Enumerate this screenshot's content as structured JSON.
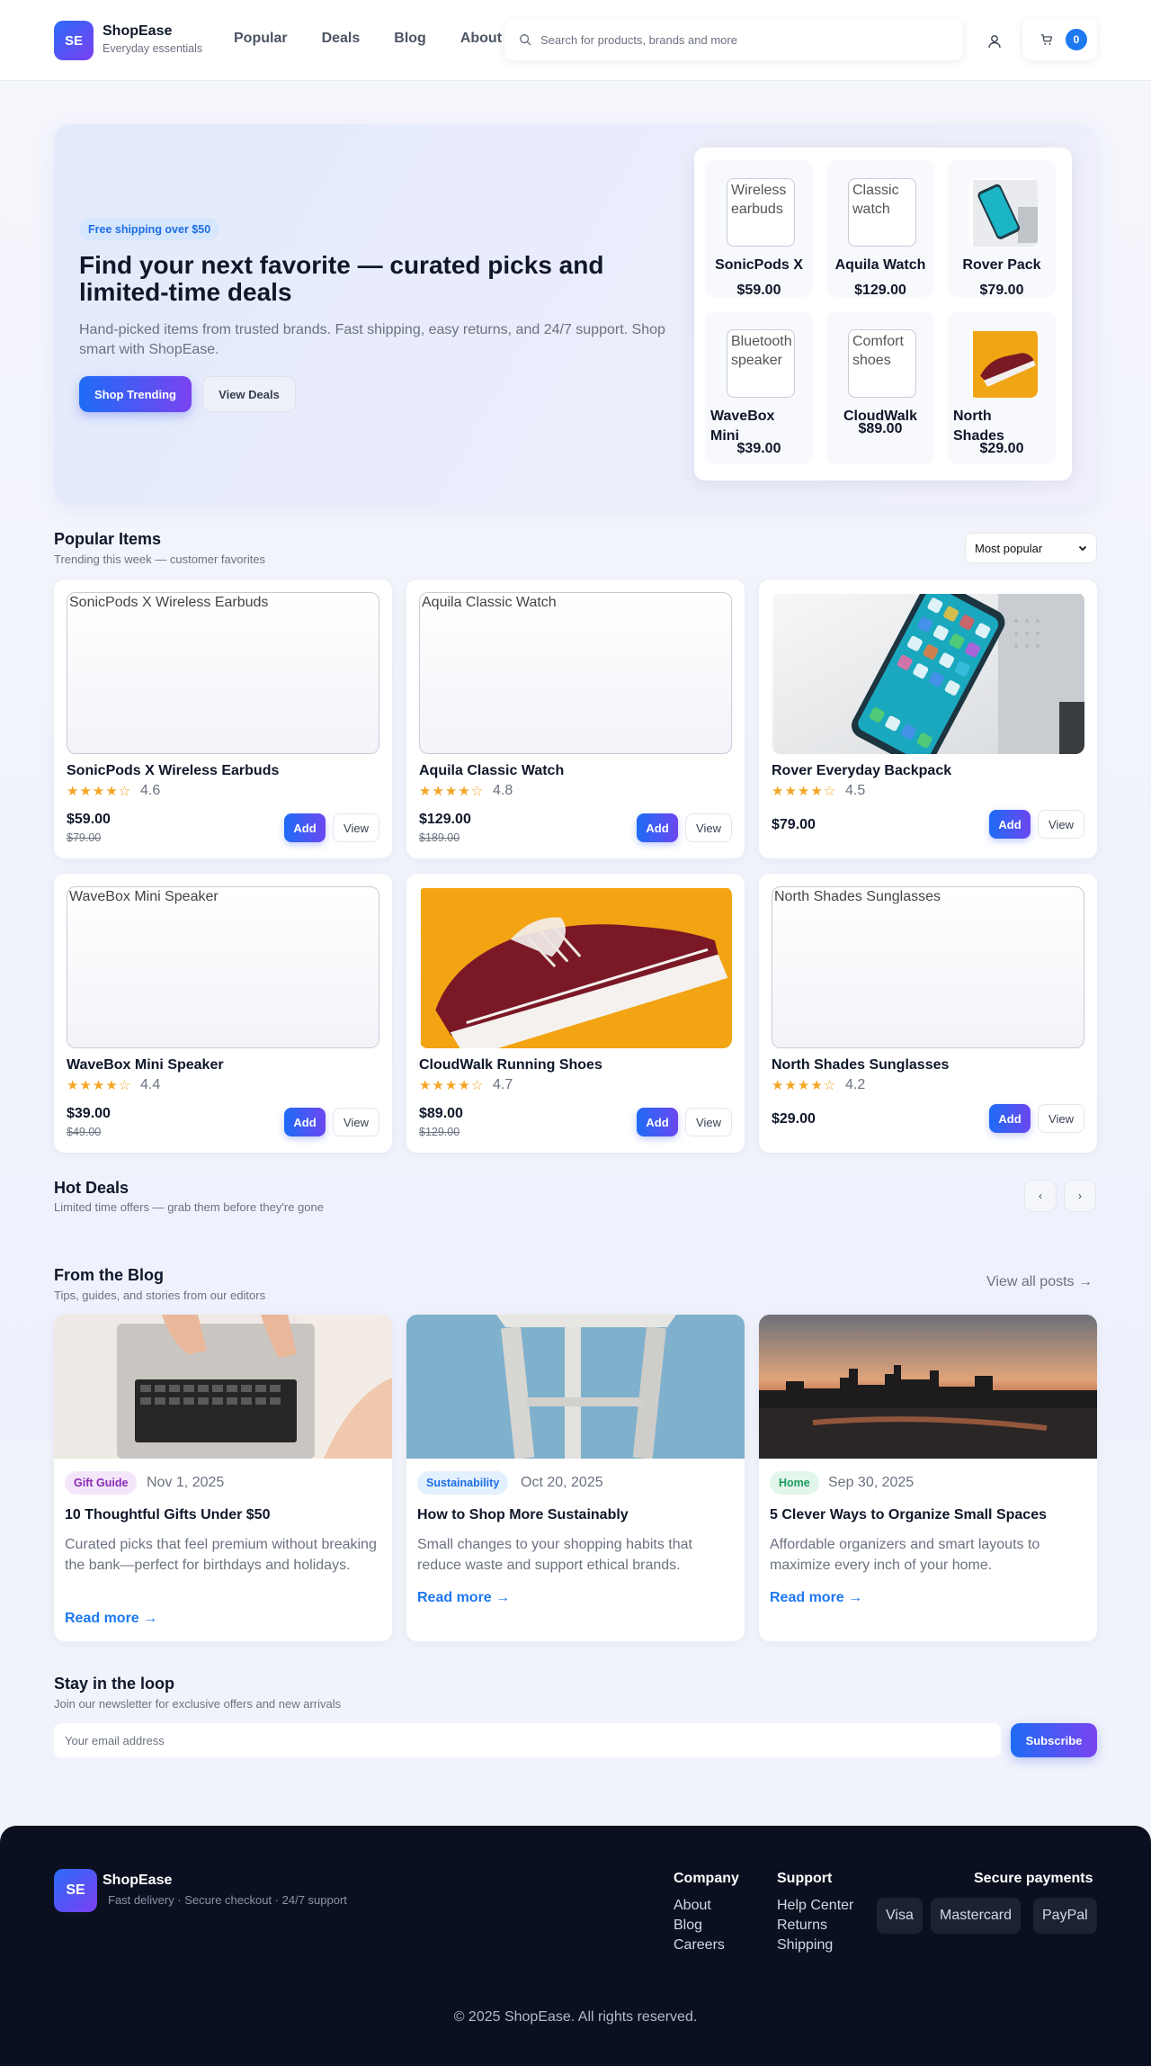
{
  "header": {
    "logo": "SE",
    "brand": "ShopEase",
    "tagline": "Everyday essentials",
    "nav": [
      "Popular",
      "Deals",
      "Blog",
      "About"
    ],
    "search_placeholder": "Search for products, brands and more",
    "cart_count": "0"
  },
  "hero": {
    "pill": "Free shipping over $50",
    "title": "Find your next favorite — curated picks and limited-time deals",
    "subtitle": "Hand-picked items from trusted brands. Fast shipping, easy returns, and 24/7 support. Shop smart with ShopEase.",
    "primary_btn": "Shop Trending",
    "secondary_btn": "View Deals",
    "minis": [
      {
        "alt": "Wireless earbuds",
        "name": "SonicPods X",
        "price": "$59.00"
      },
      {
        "alt": "Classic watch",
        "name": "Aquila Watch",
        "price": "$129.00"
      },
      {
        "alt": "",
        "name": "Rover Pack",
        "price": "$79.00"
      },
      {
        "alt": "Bluetooth speaker",
        "name": "WaveBox Mini",
        "price": "$39.00"
      },
      {
        "alt": "Comfort shoes",
        "name": "CloudWalk",
        "price": "$89.00"
      },
      {
        "alt": "",
        "name": "North Shades",
        "price": "$29.00"
      }
    ]
  },
  "popular": {
    "title": "Popular Items",
    "subtitle": "Trending this week — customer favorites",
    "sort_selected": "Most popular",
    "add_label": "Add",
    "view_label": "View",
    "items": [
      {
        "alt": "SonicPods X Wireless Earbuds",
        "name": "SonicPods X Wireless Earbuds",
        "stars": "★★★★☆",
        "rating": "4.6",
        "price": "$59.00",
        "old_price": "$79.00"
      },
      {
        "alt": "Aquila Classic Watch",
        "name": "Aquila Classic Watch",
        "stars": "★★★★☆",
        "rating": "4.8",
        "price": "$129.00",
        "old_price": "$189.00"
      },
      {
        "alt": "",
        "name": "Rover Everyday Backpack",
        "stars": "★★★★☆",
        "rating": "4.5",
        "price": "$79.00",
        "old_price": ""
      },
      {
        "alt": "WaveBox Mini Speaker",
        "name": "WaveBox Mini Speaker",
        "stars": "★★★★☆",
        "rating": "4.4",
        "price": "$39.00",
        "old_price": "$49.00"
      },
      {
        "alt": "",
        "name": "CloudWalk Running Shoes",
        "stars": "★★★★☆",
        "rating": "4.7",
        "price": "$89.00",
        "old_price": "$129.00"
      },
      {
        "alt": "North Shades Sunglasses",
        "name": "North Shades Sunglasses",
        "stars": "★★★★☆",
        "rating": "4.2",
        "price": "$29.00",
        "old_price": ""
      }
    ]
  },
  "deals": {
    "title": "Hot Deals",
    "subtitle": "Limited time offers — grab them before they're gone",
    "prev": "‹",
    "next": "›"
  },
  "blog": {
    "title": "From the Blog",
    "subtitle": "Tips, guides, and stories from our editors",
    "view_all": "View all posts →",
    "posts": [
      {
        "tag": "Gift Guide",
        "date": "Nov 1, 2025",
        "title": "10 Thoughtful Gifts Under $50",
        "desc": "Curated picks that feel premium without breaking the bank—perfect for birthdays and holidays.",
        "read": "Read more →"
      },
      {
        "tag": "Sustainability",
        "date": "Oct 20, 2025",
        "title": "How to Shop More Sustainably",
        "desc": "Small changes to your shopping habits that reduce waste and support ethical brands.",
        "read": "Read more →"
      },
      {
        "tag": "Home",
        "date": "Sep 30, 2025",
        "title": "5 Clever Ways to Organize Small Spaces",
        "desc": "Affordable organizers and smart layouts to maximize every inch of your home.",
        "read": "Read more →"
      }
    ]
  },
  "newsletter": {
    "title": "Stay in the loop",
    "subtitle": "Join our newsletter for exclusive offers and new arrivals",
    "placeholder": "Your email address",
    "button": "Subscribe"
  },
  "footer": {
    "logo": "SE",
    "brand": "ShopEase",
    "tagline": "Fast delivery · Secure checkout · 24/7 support",
    "company_title": "Company",
    "company_links": [
      "About",
      "Blog",
      "Careers"
    ],
    "support_title": "Support",
    "support_links": [
      "Help Center",
      "Returns",
      "Shipping"
    ],
    "payments_title": "Secure payments",
    "payments": [
      "Visa",
      "Mastercard",
      "PayPal"
    ],
    "copyright": "© 2025 ShopEase. All rights reserved."
  },
  "colors": {
    "accent": "#1e78f0",
    "gradient_start": "#1e6cf6",
    "gradient_end": "#7a43f0",
    "star": "#f5a524",
    "footer_bg": "#0b1020"
  }
}
